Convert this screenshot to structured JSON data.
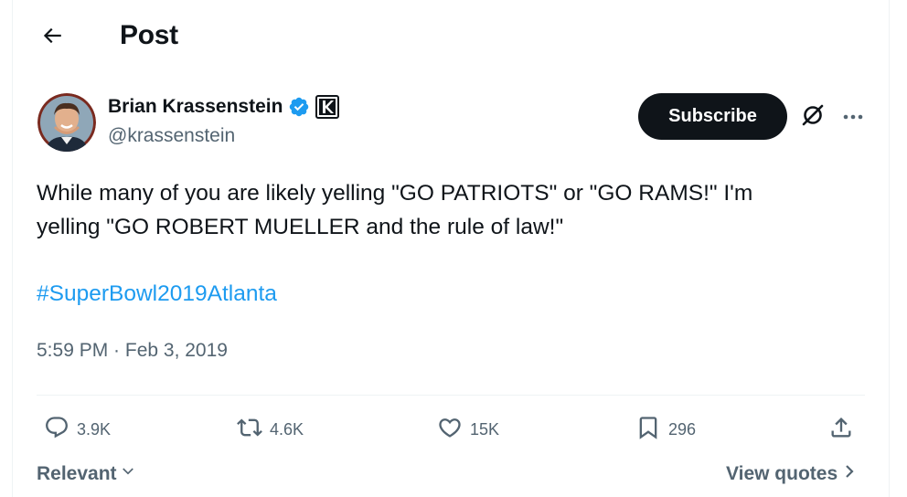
{
  "header": {
    "title": "Post"
  },
  "author": {
    "name": "Brian Krassenstein",
    "handle": "@krassenstein",
    "verified_color": "#1d9bf0"
  },
  "subscribe_label": "Subscribe",
  "tweet": {
    "line1": "While many of you are likely yelling \"GO PATRIOTS\" or \"GO RAMS!\" I'm",
    "line2": "yelling \"GO ROBERT MUELLER and the rule of law!\"",
    "hashtag": "#SuperBowl2019Atlanta",
    "timestamp": "5:59 PM · Feb 3, 2019"
  },
  "actions": {
    "replies": "3.9K",
    "retweets": "4.6K",
    "likes": "15K",
    "bookmarks": "296"
  },
  "footer": {
    "sort_label": "Relevant",
    "view_quotes_label": "View quotes"
  },
  "icons": {
    "back": "arrow-left-icon",
    "verified": "verified-badge-icon",
    "affiliate": "affiliate-k-icon",
    "grok": "grok-icon",
    "more": "more-dots-icon",
    "reply": "reply-icon",
    "retweet": "retweet-icon",
    "like": "heart-icon",
    "bookmark": "bookmark-icon",
    "share": "share-icon"
  },
  "colors": {
    "link": "#1d9bf0",
    "muted": "#536471",
    "text": "#0f1419"
  }
}
